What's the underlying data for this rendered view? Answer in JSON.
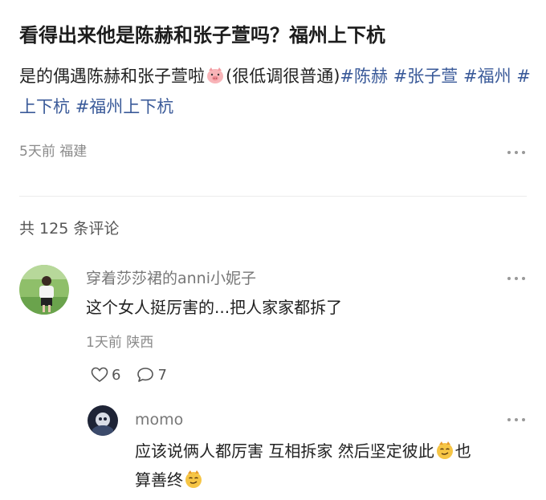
{
  "post": {
    "title": "看得出来他是陈赫和张子萱吗？福州上下杭",
    "body_text": "是的偶遇陈赫和张子萱啦",
    "body_emoji": "pig-face-emoji",
    "body_note": "(很低调很普通)",
    "hashtags": [
      "#陈赫",
      "#张子萱",
      "#福州",
      "#上下杭",
      "#福州上下杭"
    ],
    "time": "5天前",
    "location": "福建"
  },
  "comments_header": {
    "count_label": "共 125 条评论"
  },
  "comments": [
    {
      "username": "穿着莎莎裙的anni小妮子",
      "text": "这个女人挺厉害的...把人家家都拆了",
      "time": "1天前",
      "location": "陕西",
      "likes": "6",
      "replies": "7"
    }
  ],
  "reply": {
    "username": "momo",
    "text_part1": "应该说俩人都厉害 互相拆家 然后坚定彼此",
    "text_part2": "也",
    "text_part3": "算善终",
    "emoji": "smirk-face-emoji"
  },
  "colors": {
    "hashtag": "#3a5a99",
    "meta_gray": "#8a8a8a",
    "divider": "#ececec"
  },
  "icons": [
    "more-dots-icon",
    "heart-icon",
    "comment-bubble-icon"
  ]
}
